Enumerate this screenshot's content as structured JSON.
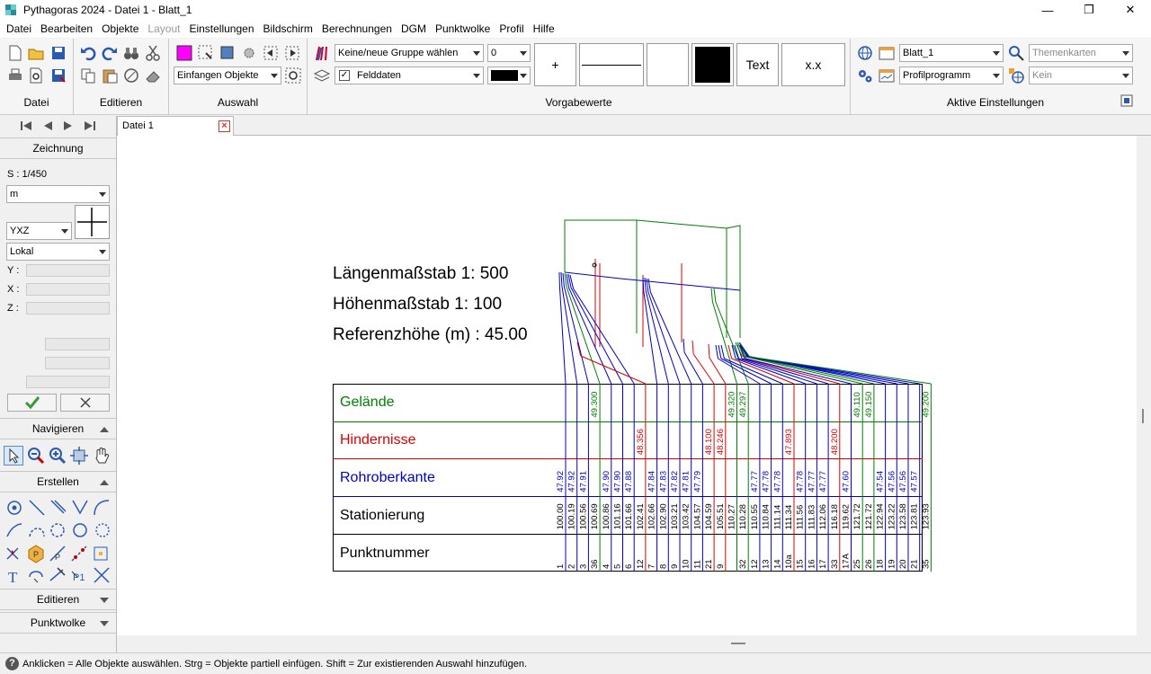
{
  "window": {
    "title": "Pythagoras 2024 - Datei 1 - Blatt_1",
    "minimize": "—",
    "maximize": "❐",
    "close": "✕"
  },
  "menu": [
    "Datei",
    "Bearbeiten",
    "Objekte",
    "Layout",
    "Einstellungen",
    "Bildschirm",
    "Berechnungen",
    "DGM",
    "Punktwolke",
    "Profil",
    "Hilfe"
  ],
  "ribbon": {
    "groups": {
      "datei": "Datei",
      "editieren": "Editieren",
      "auswahl": "Auswahl",
      "vorgabewerte": "Vorgabewerte",
      "aktive": "Aktive Einstellungen"
    },
    "auswahl_combo": "Einfangen Objekte",
    "group_combo": "Keine/neue Gruppe wählen",
    "layer_combo": "Felddaten",
    "layer_checked": true,
    "number_combo": "0",
    "plus_button": "+",
    "text_button": "Text",
    "xx_button": "x.x",
    "sheet_combo": "Blatt_1",
    "profile_combo": "Profilprogramm",
    "themen_combo": "Themenkarten",
    "kein_combo": "Kein"
  },
  "tab": {
    "label": "Datei 1"
  },
  "left": {
    "zeichnung": "Zeichnung",
    "scale": "S : 1/450",
    "unit": "m",
    "axes": "YXZ",
    "coord": "Lokal",
    "y": "Y :",
    "x": "X :",
    "z": "Z :",
    "navigieren": "Navigieren",
    "erstellen": "Erstellen",
    "editieren": "Editieren",
    "punktwolke": "Punktwolke"
  },
  "drawing": {
    "laengen": "Längenmaßstab 1: 500",
    "hoehen": "Höhenmaßstab 1: 100",
    "referenz": "Referenzhöhe (m) : 45.00",
    "rows": [
      "Gelände",
      "Hindernisse",
      "Rohroberkante",
      "Stationierung",
      "Punktnummer"
    ],
    "colors": {
      "gelaende": "#008000",
      "hinder": "#e00000",
      "rohr": "#0000c8"
    },
    "columns": [
      {
        "pn": "1",
        "st": "100.00",
        "rohr": "47.92",
        "gel": "",
        "hin": "",
        "c": "b"
      },
      {
        "pn": "2",
        "st": "100.19",
        "rohr": "47.92",
        "gel": "",
        "hin": "",
        "c": "b"
      },
      {
        "pn": "3",
        "st": "100.56",
        "rohr": "47.91",
        "gel": "",
        "hin": "",
        "c": "b"
      },
      {
        "pn": "36",
        "st": "100.69",
        "rohr": "",
        "gel": "49.300",
        "hin": "",
        "c": "g"
      },
      {
        "pn": "4",
        "st": "100.86",
        "rohr": "47.90",
        "gel": "",
        "hin": "",
        "c": "b"
      },
      {
        "pn": "5",
        "st": "101.16",
        "rohr": "47.90",
        "gel": "",
        "hin": "",
        "c": "b"
      },
      {
        "pn": "6",
        "st": "101.66",
        "rohr": "47.88",
        "gel": "",
        "hin": "",
        "c": "b"
      },
      {
        "pn": "12",
        "st": "102.41",
        "rohr": "",
        "gel": "",
        "hin": "48.356",
        "c": "r"
      },
      {
        "pn": "7",
        "st": "102.66",
        "rohr": "47.84",
        "gel": "",
        "hin": "",
        "c": "b"
      },
      {
        "pn": "8",
        "st": "102.90",
        "rohr": "47.83",
        "gel": "",
        "hin": "",
        "c": "b"
      },
      {
        "pn": "9",
        "st": "103.21",
        "rohr": "47.82",
        "gel": "",
        "hin": "",
        "c": "b"
      },
      {
        "pn": "10",
        "st": "103.42",
        "rohr": "47.81",
        "gel": "",
        "hin": "",
        "c": "b"
      },
      {
        "pn": "11",
        "st": "104.57",
        "rohr": "47.79",
        "gel": "",
        "hin": "",
        "c": "b"
      },
      {
        "pn": "21",
        "st": "104.59",
        "rohr": "",
        "gel": "",
        "hin": "48.100",
        "c": "r"
      },
      {
        "pn": "9",
        "st": "105.51",
        "rohr": "",
        "gel": "",
        "hin": "48.246",
        "c": "r"
      },
      {
        "pn": "",
        "st": "110.27",
        "rohr": "",
        "gel": "49.320",
        "hin": "",
        "c": "g"
      },
      {
        "pn": "32",
        "st": "110.28",
        "rohr": "",
        "gel": "49.297",
        "hin": "",
        "c": "g"
      },
      {
        "pn": "12",
        "st": "110.55",
        "rohr": "47.77",
        "gel": "",
        "hin": "",
        "c": "b"
      },
      {
        "pn": "13",
        "st": "110.84",
        "rohr": "47.78",
        "gel": "",
        "hin": "",
        "c": "b"
      },
      {
        "pn": "14",
        "st": "111.14",
        "rohr": "47.78",
        "gel": "",
        "hin": "",
        "c": "b"
      },
      {
        "pn": "10a",
        "st": "111.34",
        "rohr": "",
        "gel": "",
        "hin": "47.893",
        "c": "r"
      },
      {
        "pn": "15",
        "st": "111.56",
        "rohr": "47.78",
        "gel": "",
        "hin": "",
        "c": "b"
      },
      {
        "pn": "16",
        "st": "111.83",
        "rohr": "47.77",
        "gel": "",
        "hin": "",
        "c": "b"
      },
      {
        "pn": "17",
        "st": "112.06",
        "rohr": "47.77",
        "gel": "",
        "hin": "",
        "c": "b"
      },
      {
        "pn": "33",
        "st": "116.18",
        "rohr": "",
        "gel": "",
        "hin": "48.200",
        "c": "r"
      },
      {
        "pn": "17A",
        "st": "119.62",
        "rohr": "47.60",
        "gel": "",
        "hin": "",
        "c": "b"
      },
      {
        "pn": "25",
        "st": "121.72",
        "rohr": "",
        "gel": "49.110",
        "hin": "",
        "c": "g"
      },
      {
        "pn": "26",
        "st": "121.72",
        "rohr": "",
        "gel": "49.150",
        "hin": "",
        "c": "g"
      },
      {
        "pn": "18",
        "st": "122.94",
        "rohr": "47.54",
        "gel": "",
        "hin": "",
        "c": "b"
      },
      {
        "pn": "19",
        "st": "123.22",
        "rohr": "47.56",
        "gel": "",
        "hin": "",
        "c": "b"
      },
      {
        "pn": "20",
        "st": "123.58",
        "rohr": "47.56",
        "gel": "",
        "hin": "",
        "c": "b"
      },
      {
        "pn": "21",
        "st": "123.81",
        "rohr": "47.57",
        "gel": "",
        "hin": "",
        "c": "b"
      },
      {
        "pn": "35",
        "st": "123.93",
        "rohr": "",
        "gel": "49.200",
        "hin": "",
        "c": "g"
      }
    ]
  },
  "status": {
    "text": "Anklicken = Alle Objekte auswählen. Strg = Objekte partiell einfügen. Shift = Zur existierenden Auswahl hinzufügen."
  }
}
